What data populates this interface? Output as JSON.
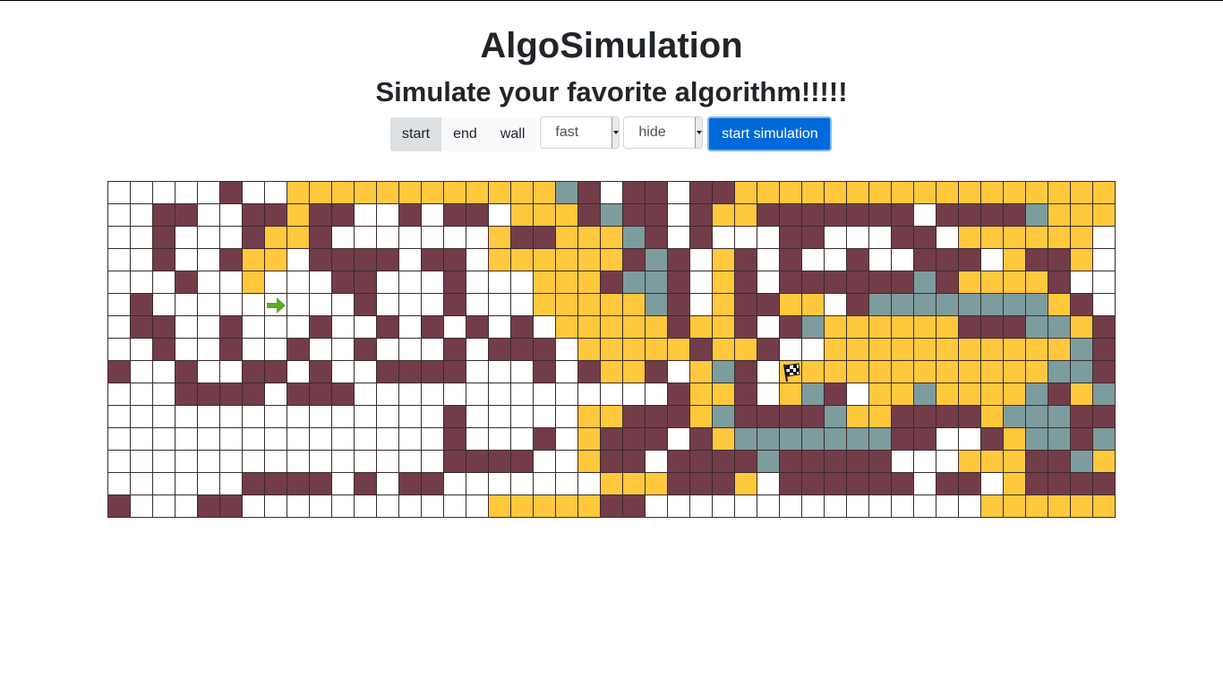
{
  "header": {
    "title": "AlgoSimulation",
    "subtitle": "Simulate your favorite algorithm!!!!!"
  },
  "controls": {
    "modes": [
      {
        "label": "start",
        "active": true
      },
      {
        "label": "end",
        "active": false
      },
      {
        "label": "wall",
        "active": false
      }
    ],
    "speed_select": {
      "selected": "fast"
    },
    "visibility_select": {
      "selected": "hide"
    },
    "simulate_label": "start simulation"
  },
  "grid": {
    "rows": 15,
    "cols": 45,
    "legend": {
      ".": "empty",
      "W": "wall",
      "Y": "visited",
      "T": "frontier",
      "S": "start",
      "E": "end"
    },
    "cells": [
      ".....W..YYYYYYYYYYYYTW.WW.WWYYYYYYYYYYYYYYYYY",
      "..WW..WWYWW..W.WW.YYYWTWW.WYYWWWWWWW.WWWWTYYY",
      "..W...WYYW.......YWWYYYTW.W...WW...WW.YYYYYY",
      "..W..WYY.WWWW.WW.YYYYYYWTW.YW.W..W..WWW.YWWY",
      "...W..Y...WW...W...YYYWTTW.YW.WWWWWWTWYYYYW",
      ".W.....S...W...W...YYYYYTW.YWWYY.WTTTTTTTTYW",
      ".WW..W...W..W.W.W.W.YYYYYWYYW.WTYYYYYYWWWTTYW",
      "..W..W..W..W...W.WWW.YYYYYWYYW..YYYYYYYYYYYTWTTYW",
      "W..W..WW.W..WWWW...W.WYYW.YTW.EYYYYYYYYYYYTTWYY",
      "...WWWW.WWW..............WYYW.YTW.YYTYYYYTWYTTTWWY",
      "...............W.....YYWWWYTWWWWTYYWWWWYTTTWWY",
      "...............W...W.YWWW.WYTTTTTTTWW..WYTTWTWY",
      "...............WWWW..YWW.WWWWTWWWWW...YYYWWTYYY",
      "......WWWW.W.WW.......YYYWWWY.WWWWWW.WW.YWWWWTYYY",
      "W...WW...........YYYYYWW...............YYYYYYYY"
    ],
    "start_icon": "arrow-right-icon",
    "end_icon": "checkered-flag-icon",
    "colors": {
      "empty": "#ffffff",
      "wall": "#733c49",
      "visited": "#ffc83d",
      "frontier": "#7d9c9e",
      "start_arrow": "#5aac1f"
    }
  }
}
